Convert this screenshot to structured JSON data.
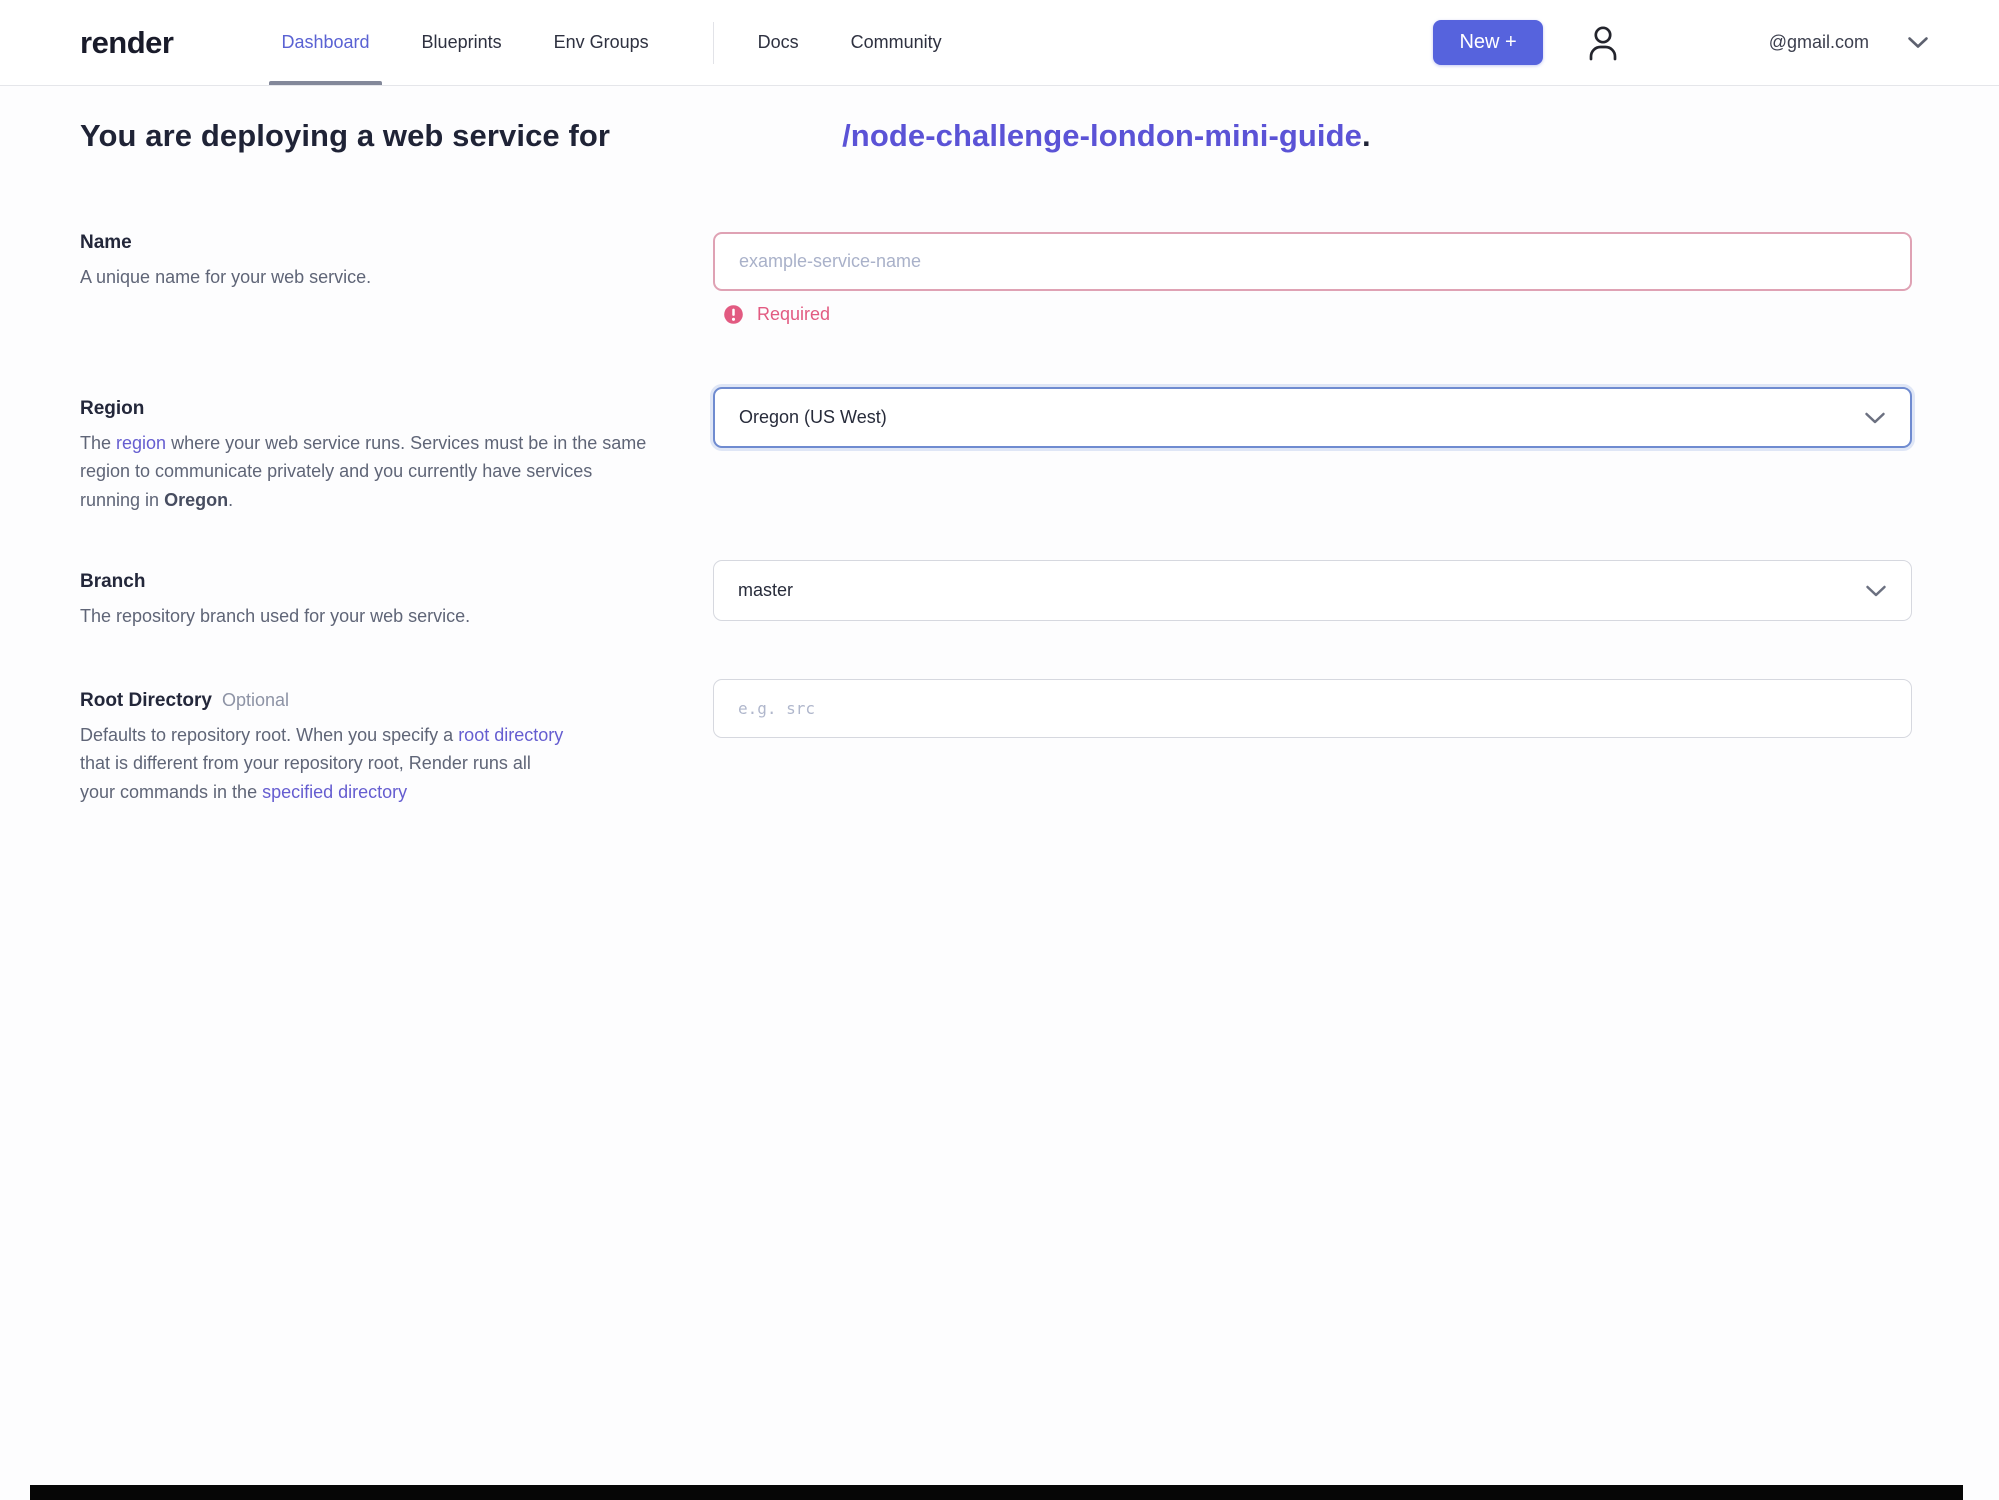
{
  "header": {
    "logo": "render",
    "nav": [
      {
        "label": "Dashboard"
      },
      {
        "label": "Blueprints"
      },
      {
        "label": "Env Groups"
      },
      {
        "label": "Docs"
      },
      {
        "label": "Community"
      }
    ],
    "new_button_label": "New +",
    "account_email": "@gmail.com"
  },
  "title": {
    "prefix": "You are deploying a web service for",
    "repo": "/node-challenge-london-mini-guide",
    "suffix": "."
  },
  "form": {
    "name": {
      "label": "Name",
      "description": "A unique name for your web service.",
      "placeholder": "example-service-name",
      "value": "",
      "error": "Required"
    },
    "region": {
      "label": "Region",
      "desc_1": "The ",
      "desc_link": "region",
      "desc_2": " where your web service runs. Services must be in the same region to communicate privately and you currently have services running in ",
      "desc_bold": "Oregon",
      "desc_3": ".",
      "value": "Oregon (US West)"
    },
    "branch": {
      "label": "Branch",
      "description": "The repository branch used for your web service.",
      "value": "master"
    },
    "root_directory": {
      "label": "Root Directory",
      "optional": "Optional",
      "desc_1": "Defaults to repository root. When you specify a ",
      "desc_link1": "root directory",
      "desc_2": " that is different from your repository root, Render runs all your commands in the ",
      "desc_link2": "specified directory",
      "placeholder": "e.g. src",
      "value": ""
    }
  },
  "colors": {
    "accent": "#5663dd",
    "active_nav": "#5a62d3",
    "repo_link": "#5b53d6",
    "error": "#e25a81",
    "error_border": "#dfa2b4",
    "focus_border": "#6f8bd0"
  }
}
